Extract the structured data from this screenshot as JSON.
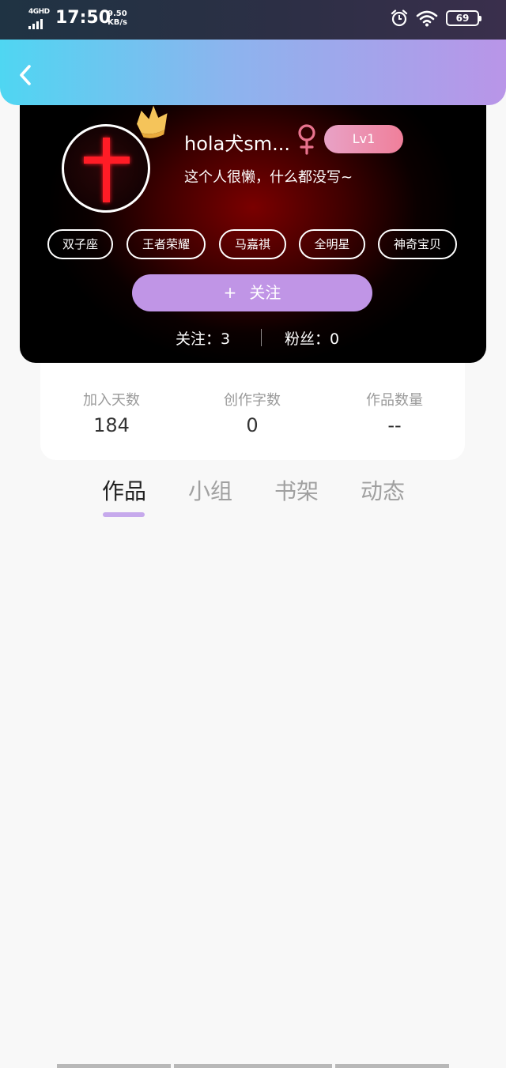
{
  "status_bar": {
    "network": "4GHD",
    "time": "17:50",
    "speed_value": "9.50",
    "speed_unit": "KB/s",
    "battery": "69",
    "icons": [
      "signal-icon",
      "alarm-icon",
      "wifi-icon",
      "battery-icon"
    ]
  },
  "header": {
    "back_icon": "chevron-left-icon"
  },
  "profile": {
    "username": "hola犬sm...",
    "gender_symbol": "♀",
    "level": "Lv1",
    "signature": "这个人很懒，什么都没写~",
    "tags": [
      "双子座",
      "王者荣耀",
      "马嘉祺",
      "全明星",
      "神奇宝贝"
    ],
    "follow_plus": "+",
    "follow_label": "关注",
    "following_text": "关注：3",
    "fans_text": "粉丝：0",
    "colors": {
      "follow_button": "#c095e6",
      "level_badge": "#f07f9a",
      "gender": "#e8738e"
    }
  },
  "stats": [
    {
      "label": "加入天数",
      "value": "184"
    },
    {
      "label": "创作字数",
      "value": "0"
    },
    {
      "label": "作品数量",
      "value": "--"
    }
  ],
  "tabs": [
    {
      "label": "作品",
      "active": true
    },
    {
      "label": "小组",
      "active": false
    },
    {
      "label": "书架",
      "active": false
    },
    {
      "label": "动态",
      "active": false
    }
  ],
  "theme": {
    "header_start": "#4fd6f2",
    "header_end": "#b995e8",
    "tab_indicator": "#c6a9ec"
  }
}
